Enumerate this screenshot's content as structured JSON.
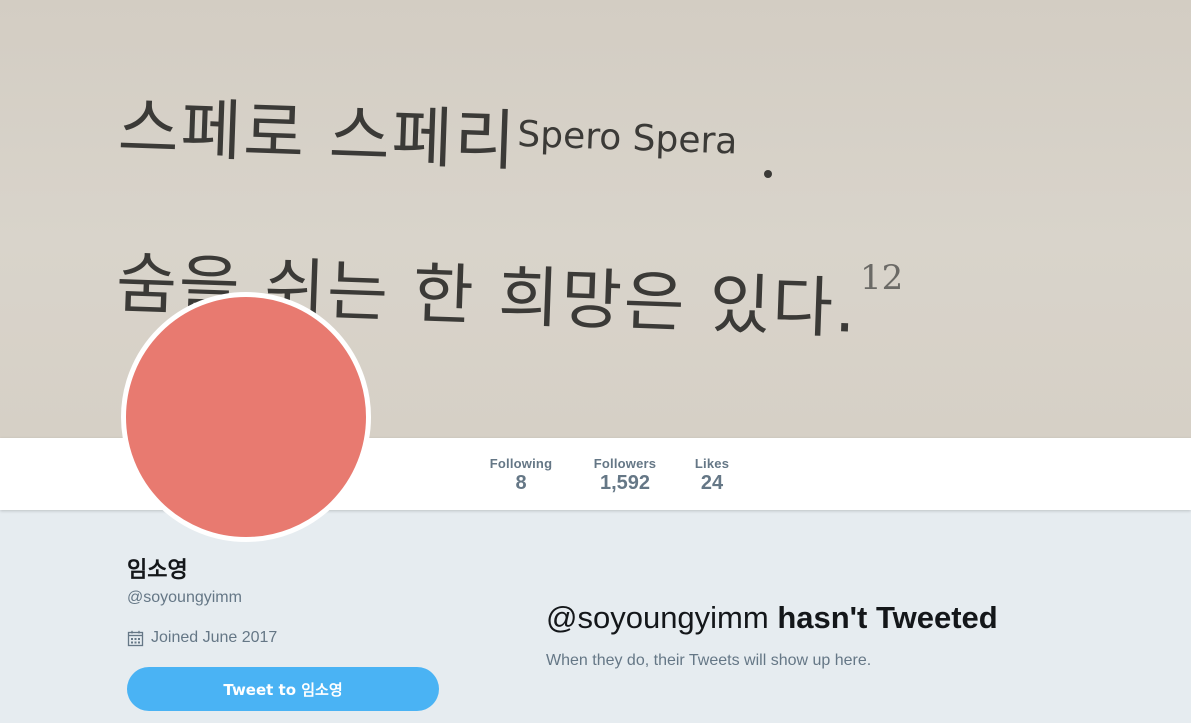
{
  "banner": {
    "line1_korean": "스페로 스페리",
    "line1_latin": "Spero Spera",
    "line2": "숨을 쉬는 한 희망은 있다.",
    "footnote": "12"
  },
  "stats": {
    "following_label": "Following",
    "following_value": "8",
    "followers_label": "Followers",
    "followers_value": "1,592",
    "likes_label": "Likes",
    "likes_value": "24"
  },
  "profile": {
    "name": "임소영",
    "handle": "@soyoungyimm",
    "joined": "Joined June 2017",
    "avatar_color": "#e87a70",
    "tweet_to_button": "Tweet to 임소영"
  },
  "timeline": {
    "empty_handle": "@soyoungyimm",
    "empty_title": " hasn't Tweeted",
    "empty_sub": "When they do, their Tweets will show up here."
  },
  "icons": {
    "calendar": "calendar-icon"
  },
  "colors": {
    "accent": "#4ab3f4",
    "page_bg": "#e6ecf0",
    "muted_text": "#657786"
  }
}
